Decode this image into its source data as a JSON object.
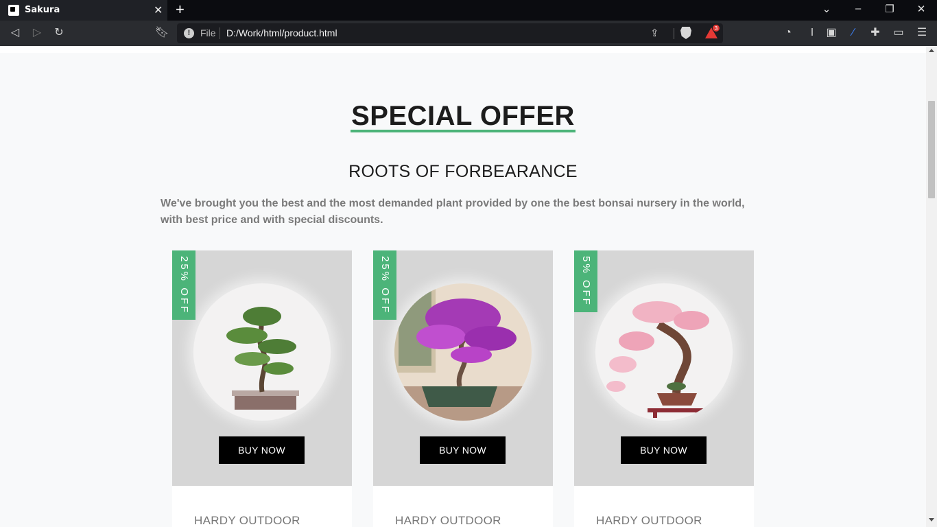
{
  "browser": {
    "tab_title": "Sakura",
    "url_scheme": "File",
    "url": "D:/Work/html/product.html",
    "rewards_count": "3"
  },
  "section": {
    "title": "SPECIAL OFFER",
    "subtitle": "ROOTS OF FORBEARANCE",
    "description": "We've brought you the best and the most demanded plant provided by one the best bonsai nursery in the world, with best price and with special discounts."
  },
  "products": [
    {
      "discount": "25% OFF",
      "button": "BUY NOW",
      "category": "HARDY OUTDOOR"
    },
    {
      "discount": "25% OFF",
      "button": "BUY NOW",
      "category": "HARDY OUTDOOR"
    },
    {
      "discount": "5% OFF",
      "button": "BUY NOW",
      "category": "HARDY OUTDOOR"
    }
  ],
  "colors": {
    "accent": "#4cb479",
    "card_top": "#d6d6d6",
    "button": "#000000"
  }
}
